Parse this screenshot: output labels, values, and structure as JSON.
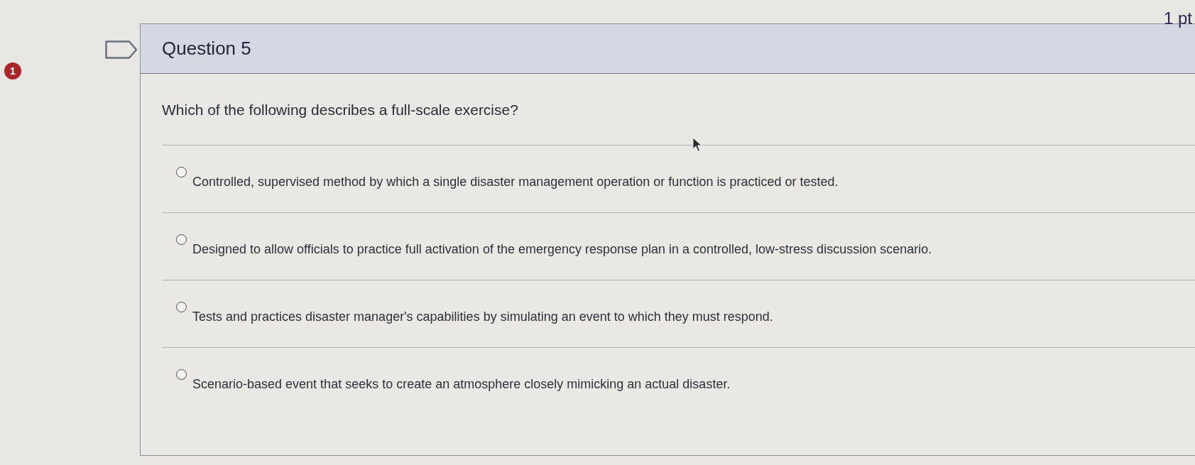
{
  "badge": {
    "count": "1"
  },
  "question": {
    "title": "Question 5",
    "points": "1 pt",
    "text": "Which of the following describes a full-scale exercise?",
    "answers": [
      {
        "text": "Controlled, supervised method by which a single disaster management operation or function is practiced or tested.",
        "selected": false
      },
      {
        "text": "Designed to allow officials to practice full activation of the emergency response plan in a controlled, low-stress discussion scenario.",
        "selected": false
      },
      {
        "text": "Tests and practices disaster manager's capabilities by simulating an event to which they must respond.",
        "selected": false
      },
      {
        "text": "Scenario-based event that seeks to create an atmosphere closely mimicking an actual disaster.",
        "selected": false
      }
    ]
  }
}
